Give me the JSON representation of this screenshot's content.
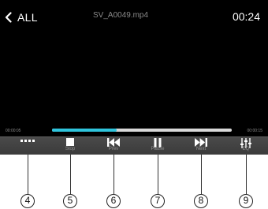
{
  "header": {
    "back_label": "ALL",
    "file_name": "SV_A0049.mp4",
    "clock": "00:24"
  },
  "playback": {
    "elapsed": "00:00:05",
    "duration": "00:00:15",
    "progress_fraction": 0.36
  },
  "controls": [
    {
      "name": "more",
      "icon": "more-dots-icon",
      "label": ""
    },
    {
      "name": "stop",
      "icon": "stop-icon",
      "label": "Stop"
    },
    {
      "name": "prev",
      "icon": "prev-track-icon",
      "label": "Prev"
    },
    {
      "name": "pause",
      "icon": "pause-icon",
      "label": "Pause"
    },
    {
      "name": "next",
      "icon": "next-track-icon",
      "label": "Next"
    },
    {
      "name": "eq",
      "icon": "equalizer-icon",
      "label": "EQ"
    }
  ],
  "callouts": [
    "4",
    "5",
    "6",
    "7",
    "8",
    "9"
  ],
  "colors": {
    "progress_fill": "#2fc4dc",
    "progress_track": "#d8d8d8",
    "control_bar": "#424242"
  }
}
